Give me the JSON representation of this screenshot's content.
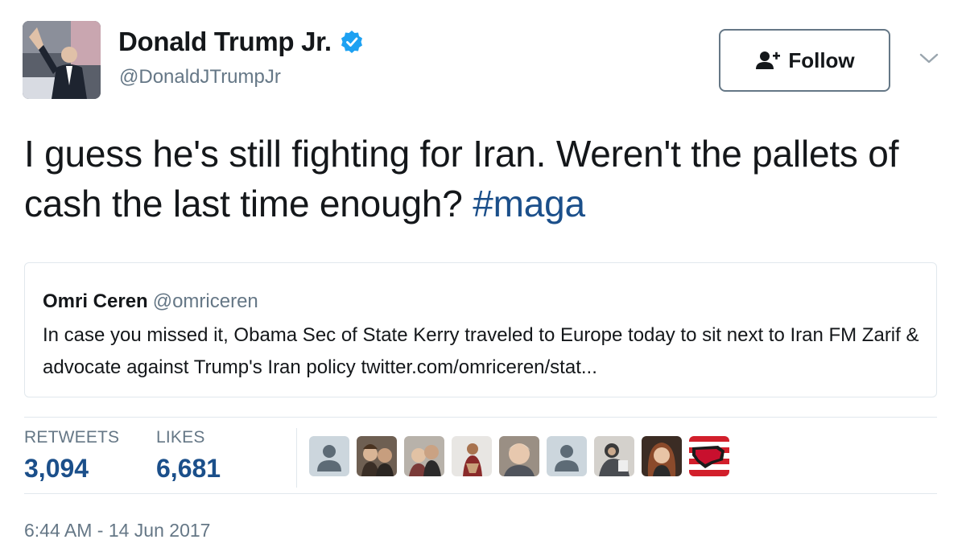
{
  "user": {
    "name": "Donald Trump Jr.",
    "handle": "@DonaldJTrumpJr",
    "verified": true,
    "avatar_icon": "profile-photo"
  },
  "follow_button": {
    "label": "Follow",
    "icon": "add-user-icon"
  },
  "tweet": {
    "text": "I guess he's still fighting for Iran. Weren't the pallets of cash the last time enough?",
    "hashtag": "#maga"
  },
  "quoted_tweet": {
    "name": "Omri Ceren",
    "handle": "@omriceren",
    "text": "In case you missed it, Obama Sec of State Kerry traveled to Europe today to sit next to Iran FM Zarif & advocate against Trump's Iran policy twitter.com/omriceren/stat..."
  },
  "stats": {
    "retweets_label": "RETWEETS",
    "retweets_value": "3,094",
    "likes_label": "LIKES",
    "likes_value": "6,681"
  },
  "likers": [
    {
      "icon": "default-avatar-icon"
    },
    {
      "icon": "photo-avatar-icon"
    },
    {
      "icon": "photo-avatar-icon"
    },
    {
      "icon": "photo-avatar-icon"
    },
    {
      "icon": "photo-avatar-icon"
    },
    {
      "icon": "default-avatar-icon"
    },
    {
      "icon": "photo-avatar-icon"
    },
    {
      "icon": "photo-avatar-icon"
    },
    {
      "icon": "flag-map-avatar-icon"
    }
  ],
  "timestamp": "6:44 AM - 14 Jun 2017",
  "colors": {
    "text": "#14171a",
    "secondary": "#657786",
    "link": "#1b4f8a",
    "verified": "#1da1f2",
    "border": "#e1e8ed"
  }
}
